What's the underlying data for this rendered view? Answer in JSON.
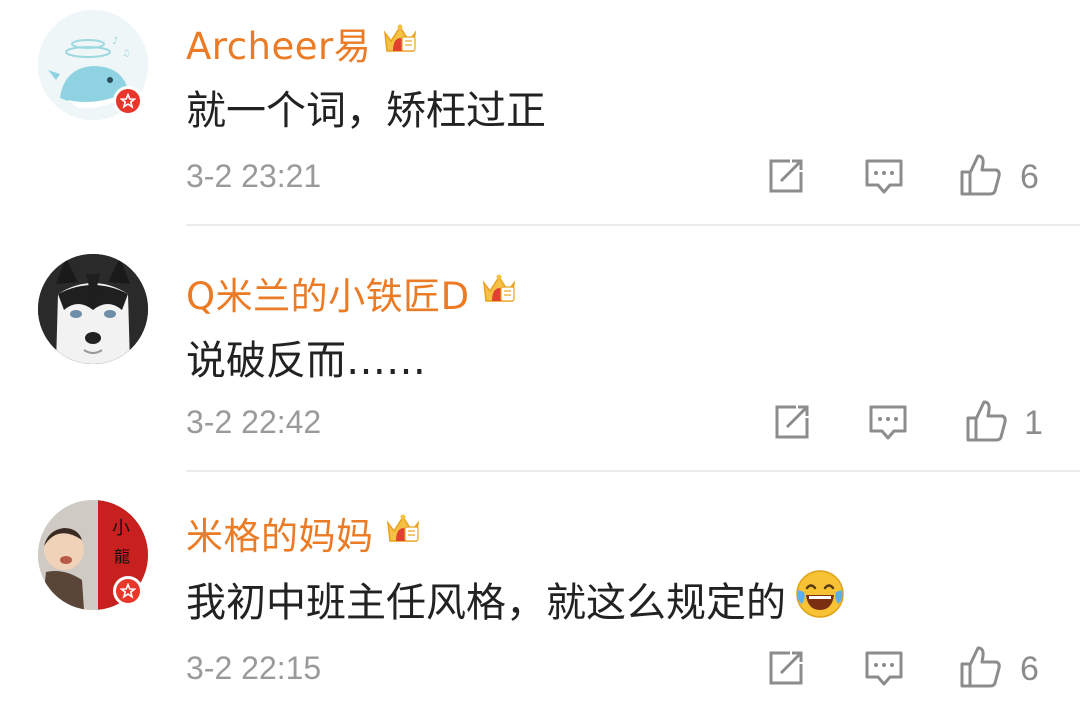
{
  "comments": [
    {
      "username": "Archeer易",
      "text": "就一个词，矫枉过正",
      "time": "3-2 23:21",
      "likes": "6",
      "avatar_icon": "whale-avatar",
      "verified": true
    },
    {
      "username": "Q米兰的小铁匠D",
      "text": "说破反而……",
      "time": "3-2 22:42",
      "likes": "1",
      "avatar_icon": "husky-dog-avatar",
      "verified": false
    },
    {
      "username": "米格的妈妈",
      "text": "我初中班主任风格，就这么规定的",
      "time": "3-2 22:15",
      "likes": "6",
      "avatar_icon": "baby-with-red-couplet-avatar",
      "verified": true,
      "emoji": "laughing-tears-emoji"
    }
  ],
  "colors": {
    "username": "#eb7b24",
    "text": "#222222",
    "meta": "#9a9a9a",
    "badge": "#e8362a"
  }
}
